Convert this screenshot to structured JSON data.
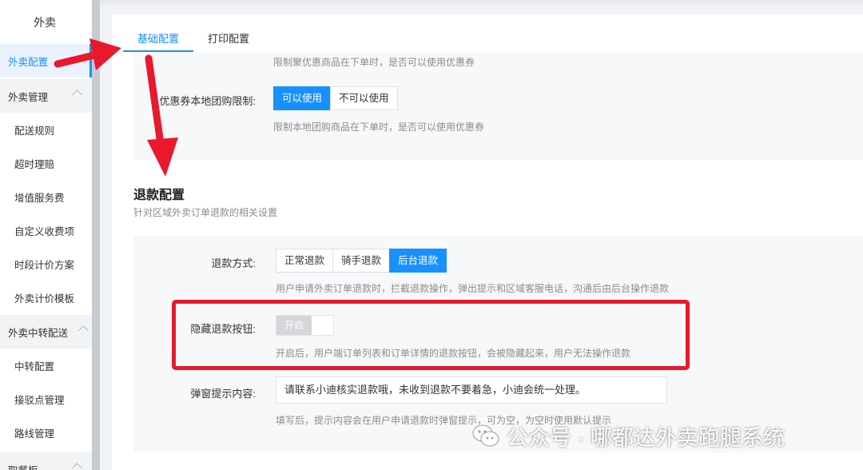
{
  "sidebar": {
    "title": "外卖",
    "items": [
      {
        "label": "外卖配置",
        "kind": "active"
      },
      {
        "label": "外卖管理",
        "kind": "group"
      },
      {
        "label": "配送规则",
        "kind": "sub"
      },
      {
        "label": "超时理赔",
        "kind": "sub"
      },
      {
        "label": "增值服务费",
        "kind": "sub"
      },
      {
        "label": "自定义收费项",
        "kind": "sub"
      },
      {
        "label": "时段计价方案",
        "kind": "sub"
      },
      {
        "label": "外卖计价模板",
        "kind": "sub"
      },
      {
        "label": "外卖中转配送",
        "kind": "group"
      },
      {
        "label": "中转配置",
        "kind": "sub"
      },
      {
        "label": "接驳点管理",
        "kind": "sub"
      },
      {
        "label": "路线管理",
        "kind": "sub"
      },
      {
        "label": "取餐柜",
        "kind": "group"
      }
    ]
  },
  "tabs": [
    {
      "label": "基础配置",
      "active": true
    },
    {
      "label": "打印配置",
      "active": false
    }
  ],
  "coupon": {
    "help_top": "限制聚优惠商品在下单时，是否可以使用优惠券",
    "label": "优惠券本地团购限制:",
    "options": [
      "可以使用",
      "不可以使用"
    ],
    "selected": "可以使用",
    "help": "限制本地团购商品在下单时，是否可以使用优惠券"
  },
  "refund_section": {
    "title": "退款配置",
    "subtitle": "针对区域外卖订单退款的相关设置"
  },
  "refund_method": {
    "label": "退款方式:",
    "options": [
      "正常退款",
      "骑手退款",
      "后台退款"
    ],
    "selected": "后台退款",
    "help": "用户申请外卖订单退款时，拦截退款操作，弹出提示和区域客服电话，沟通后由后台操作退款"
  },
  "hide_refund": {
    "label": "隐藏退款按钮:",
    "toggle_text": "开启",
    "help": "开启后，用户端订单列表和订单详情的退款按钮，会被隐藏起来，用户无法操作退款"
  },
  "popup_tip": {
    "label": "弹窗提示内容:",
    "value": "请联系小迪核实退款哦，未收到退款不要着急，小迪会统一处理。",
    "help": "填写后，提示内容会在用户申请退款时弹窗提示，可为空，为空时使用默认提示"
  },
  "annotation": {
    "color": "#e8192c"
  },
  "watermark": {
    "text": "公众号 · 哪都达外卖跑腿系统"
  },
  "colors": {
    "accent": "#1890ff"
  }
}
